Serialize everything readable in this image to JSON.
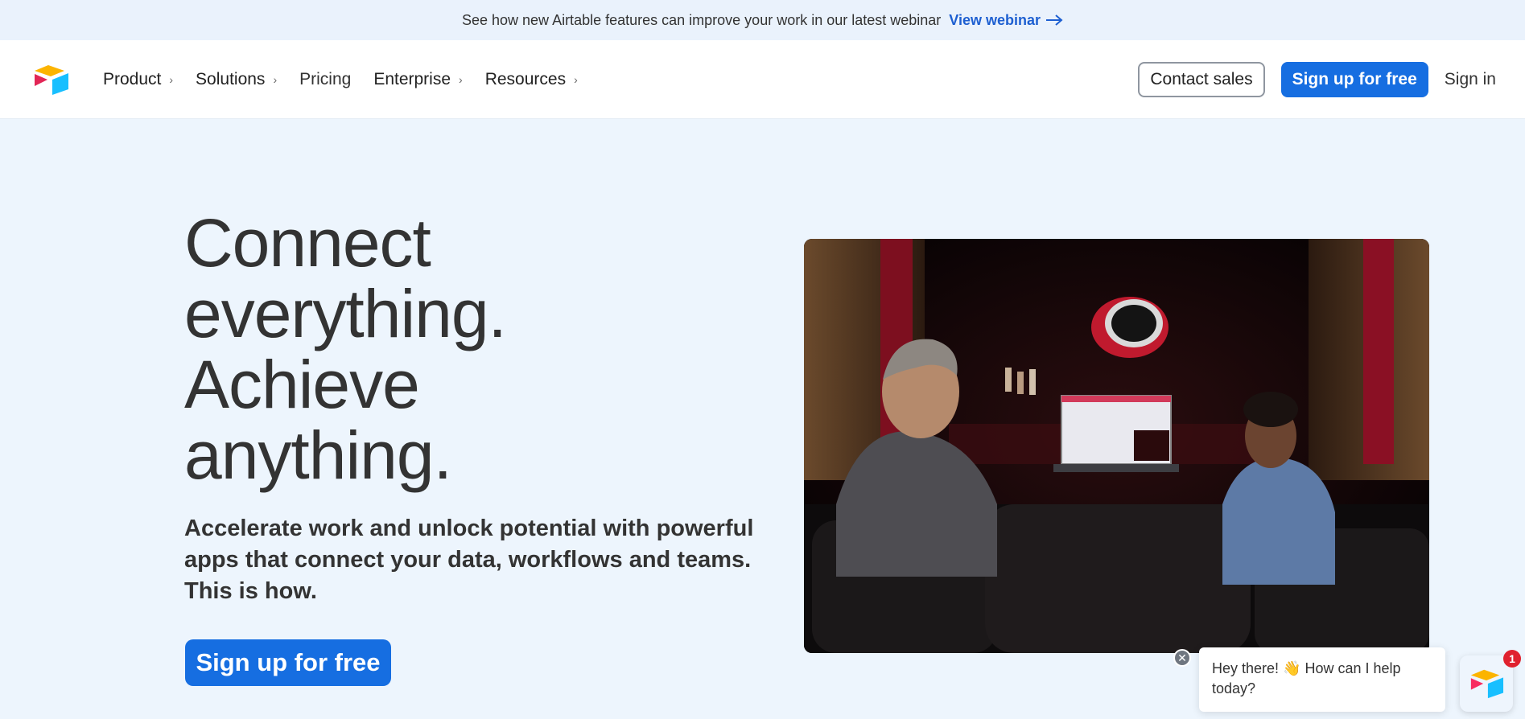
{
  "banner": {
    "text": "See how new Airtable features can improve your work in our latest webinar",
    "link_label": "View webinar",
    "link_icon": "arrow-right-icon"
  },
  "header": {
    "logo": "airtable-logo",
    "nav": [
      {
        "label": "Product",
        "has_chevron": true
      },
      {
        "label": "Solutions",
        "has_chevron": true
      },
      {
        "label": "Pricing",
        "has_chevron": false
      },
      {
        "label": "Enterprise",
        "has_chevron": true
      },
      {
        "label": "Resources",
        "has_chevron": true
      }
    ],
    "contact_sales": "Contact sales",
    "signup": "Sign up for free",
    "signin": "Sign in"
  },
  "hero": {
    "title_lines": [
      "Connect",
      "everything.",
      "Achieve",
      "anything."
    ],
    "subtitle": "Accelerate work and unlock potential with powerful apps that connect your data, workflows and teams. This is how.",
    "cta": "Sign up for free"
  },
  "chat": {
    "message": "Hey there! 👋 How can I help today?",
    "badge_count": "1",
    "close_icon": "close-icon"
  },
  "colors": {
    "accent": "#166ee1",
    "link": "#1d5fd1",
    "page_bg": "#edf5fd",
    "badge": "#e0212e"
  }
}
